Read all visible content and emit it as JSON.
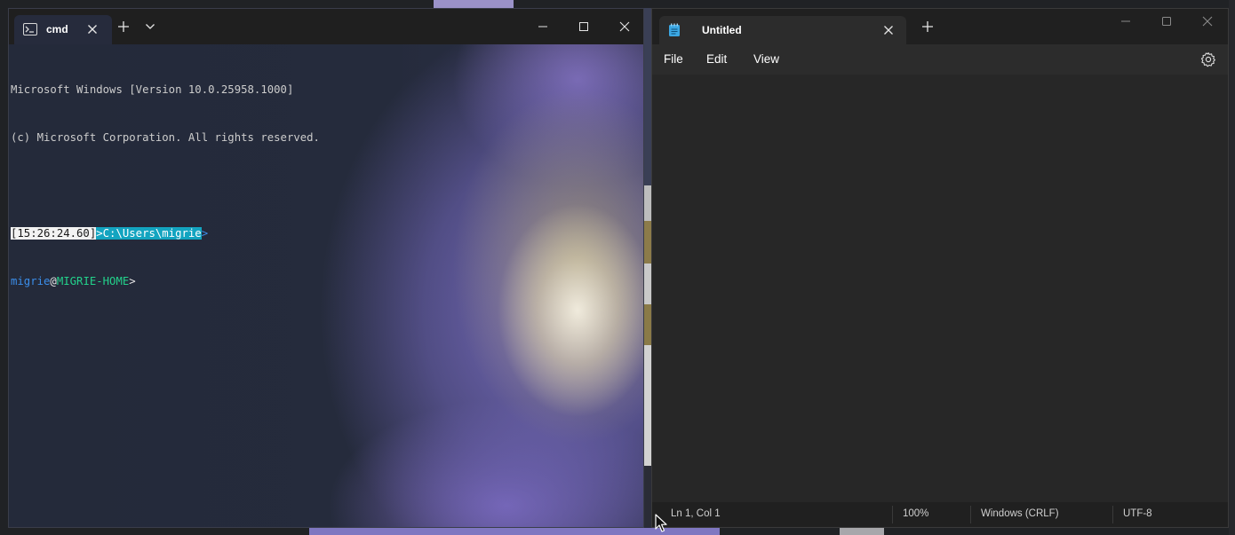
{
  "terminal": {
    "tab_title": "cmd",
    "icons": {
      "tab": "terminal-prompt-icon",
      "tab_close": "close-icon",
      "new_tab": "plus-icon",
      "dropdown": "chevron-down-icon",
      "minimize": "minimize-icon",
      "maximize": "maximize-icon",
      "close": "close-icon"
    },
    "lines": {
      "version": "Microsoft Windows [Version 10.0.25958.1000]",
      "copyright": "(c) Microsoft Corporation. All rights reserved.",
      "prompt_time": "[15:26:24.60]",
      "prompt_path": ">C:\\Users\\migrie",
      "prompt_arrow": ">",
      "user": "migrie",
      "at": "@",
      "host": "MIGRIE-HOME",
      "final_prompt": ">"
    },
    "colors": {
      "background": "#262b3c",
      "path_highlight": "#13a4c0",
      "user": "#3b8eea",
      "host": "#23d18b"
    }
  },
  "notepad": {
    "tab_title": "Untitled",
    "icons": {
      "app": "notepad-icon",
      "tab_close": "close-icon",
      "new_tab": "plus-icon",
      "minimize": "minimize-icon",
      "maximize": "maximize-icon",
      "close": "close-icon",
      "settings": "gear-icon"
    },
    "menu": {
      "file": "File",
      "edit": "Edit",
      "view": "View"
    },
    "status": {
      "position": "Ln 1, Col 1",
      "zoom": "100%",
      "line_ending": "Windows (CRLF)",
      "encoding": "UTF-8"
    }
  }
}
